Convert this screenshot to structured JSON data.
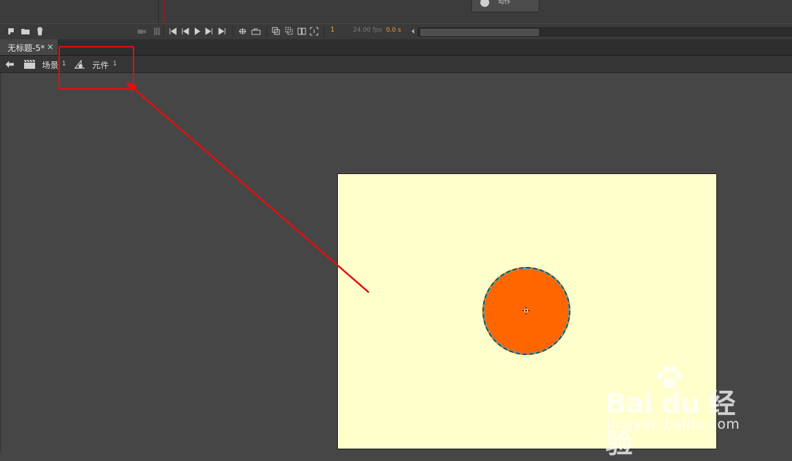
{
  "timeline": {
    "motion_button_label": "动作",
    "frame_number": "1",
    "fps": "24.00 fps",
    "seconds": "0.0 s"
  },
  "tab": {
    "title": "无标题-5*",
    "close": "×"
  },
  "breadcrumb": {
    "scene_label": "场景",
    "scene_number": "1",
    "symbol_label": "元件",
    "symbol_number": "1"
  },
  "stage": {
    "background_color": "#ffffcc",
    "instance_color": "#ff6600"
  },
  "annotation": {
    "color": "#e21010"
  },
  "watermark": {
    "brand": "Bai du 经验",
    "url": "jingyan.baidu.com"
  }
}
